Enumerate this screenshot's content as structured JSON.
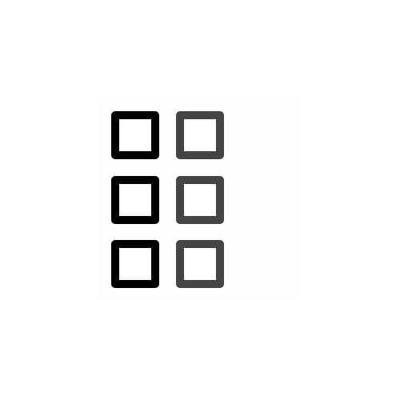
{
  "icon": {
    "name": "grid-view-icon",
    "columns": 2,
    "rows": 3,
    "colors": {
      "left_column": "#000000",
      "right_column": "#444444"
    }
  }
}
